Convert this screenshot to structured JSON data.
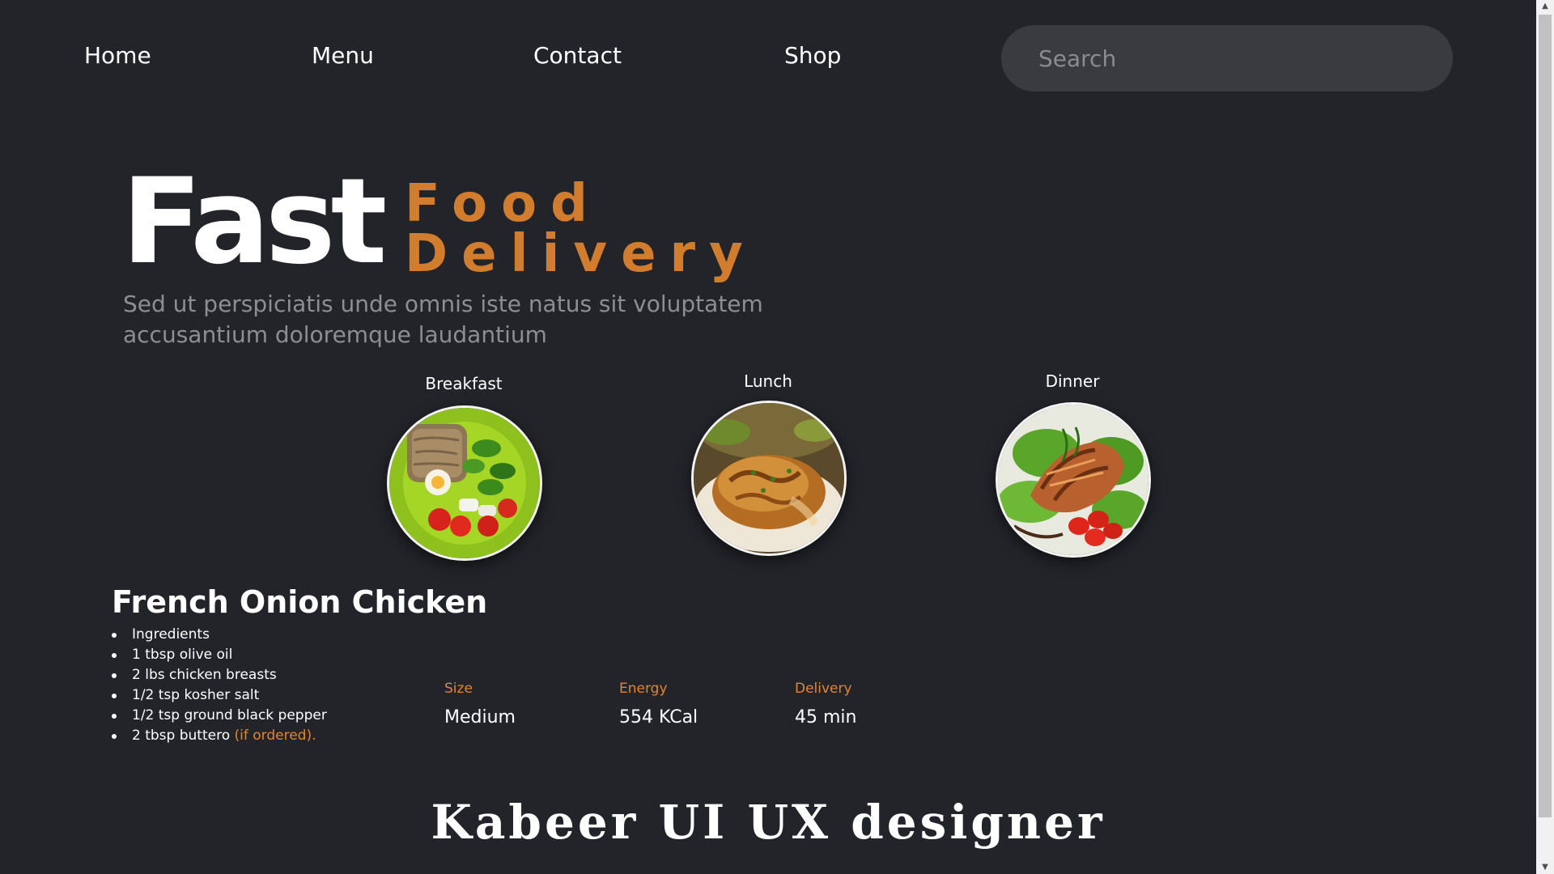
{
  "nav": {
    "items": [
      {
        "label": "Home"
      },
      {
        "label": "Menu"
      },
      {
        "label": "Contact"
      },
      {
        "label": "Shop"
      }
    ],
    "search_placeholder": "Search"
  },
  "hero": {
    "title_main": "Fast",
    "title_line1": "Food",
    "title_line2": "Delivery",
    "description": "Sed ut perspiciatis unde omnis iste natus sit voluptatem accusantium doloremque laudantium"
  },
  "meals": [
    {
      "label": "Breakfast",
      "icon": "breakfast-plate-image"
    },
    {
      "label": "Lunch",
      "icon": "lunch-plate-image"
    },
    {
      "label": "Dinner",
      "icon": "dinner-plate-image"
    }
  ],
  "recipe": {
    "title": "French Onion Chicken",
    "ingredients": [
      "Ingredients",
      "1 tbsp olive oil",
      "2 lbs chicken breasts",
      "1/2 tsp kosher salt",
      "1/2 tsp ground black pepper",
      "2 tbsp buttero"
    ],
    "ingredient_note": "(if ordered).",
    "stats": [
      {
        "label": "Size",
        "value": "Medium"
      },
      {
        "label": "Energy",
        "value": "554 KCal"
      },
      {
        "label": "Delivery",
        "value": "45 min"
      }
    ]
  },
  "footer": {
    "credit": "Kabeer UI UX designer"
  },
  "colors": {
    "background": "#23242a",
    "accent": "#d27d2d",
    "search_bg": "#3a3b41"
  }
}
